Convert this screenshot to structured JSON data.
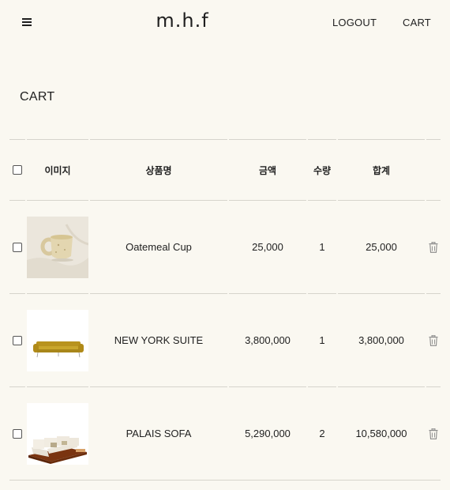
{
  "header": {
    "logo": "m.h.f",
    "logout_label": "LOGOUT",
    "cart_label": "CART"
  },
  "page": {
    "title": "CART"
  },
  "table": {
    "headers": {
      "image": "이미지",
      "name": "상품명",
      "price": "금액",
      "quantity": "수량",
      "total": "합계"
    },
    "rows": [
      {
        "name": "Oatemeal Cup",
        "price": "25,000",
        "quantity": "1",
        "total": "25,000",
        "image_icon": "ceramic-cup-photo"
      },
      {
        "name": "NEW YORK SUITE",
        "price": "3,800,000",
        "quantity": "1",
        "total": "3,800,000",
        "image_icon": "yellow-sofa-photo"
      },
      {
        "name": "PALAIS SOFA",
        "price": "5,290,000",
        "quantity": "2",
        "total": "10,580,000",
        "image_icon": "sectional-sofa-photo"
      }
    ]
  },
  "colors": {
    "background": "#faf8f1",
    "text": "#1f1f1f",
    "divider": "#d6d4cc",
    "icon_gray": "#8a8a8a"
  }
}
